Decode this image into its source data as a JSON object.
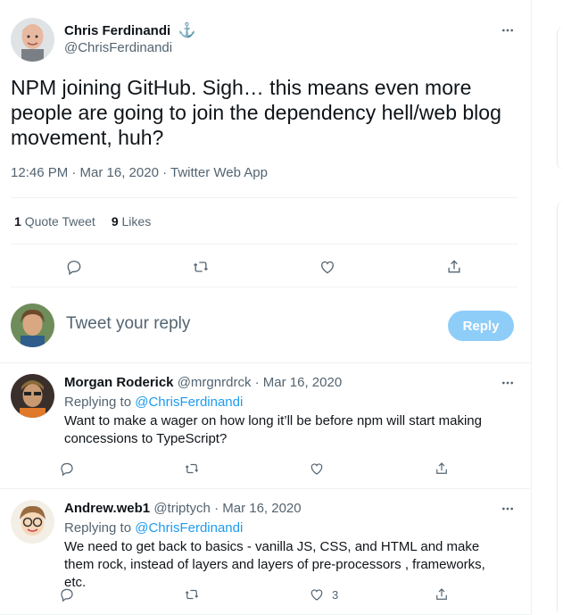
{
  "main_tweet": {
    "author_name": "Chris Ferdinandi",
    "author_handle": "@ChrisFerdinandi",
    "verified_symbol": "⚓",
    "text": "NPM joining GitHub. Sigh… this means even more people are going to join the dependency hell/web blog movement, huh?",
    "timestamp": "12:46 PM · Mar 16, 2020",
    "source": "Twitter Web App",
    "quote_tweets_count": "1",
    "quote_tweets_label": "Quote Tweet",
    "likes_count": "9",
    "likes_label": "Likes"
  },
  "reply_composer": {
    "placeholder": "Tweet your reply",
    "button_label": "Reply"
  },
  "replies": [
    {
      "author_name": "Morgan Roderick",
      "author_handle": "@mrgnrdrck",
      "date": "· Mar 16, 2020",
      "replying_label": "Replying to",
      "replying_to": "@ChrisFerdinandi",
      "text": "Want to make a wager on how long it’ll be before npm will start making concessions to TypeScript?",
      "like_count": ""
    },
    {
      "author_name": "Andrew.web1",
      "author_handle": "@triptych",
      "date": "· Mar 16, 2020",
      "replying_label": "Replying to",
      "replying_to": "@ChrisFerdinandi",
      "text": "We need to get back to basics - vanilla JS, CSS, and HTML and make them rock, instead of layers and layers of pre-processors , frameworks, etc.",
      "like_count": "3"
    }
  ],
  "colors": {
    "accent": "#1d9bf0",
    "reply_button_disabled": "#8ecdf8",
    "muted_text": "#536471"
  }
}
